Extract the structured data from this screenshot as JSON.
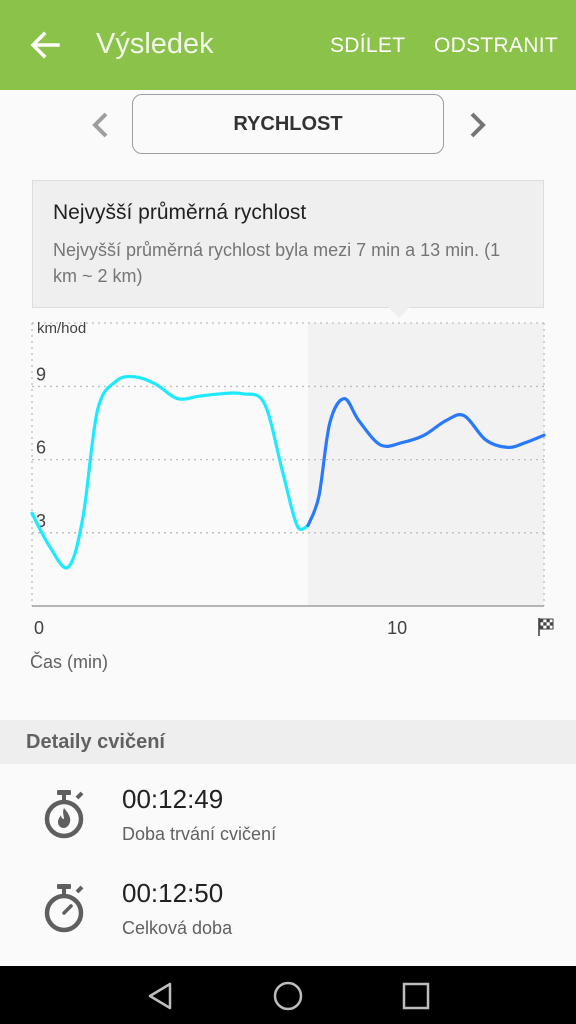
{
  "appbar": {
    "title": "Výsledek",
    "share_label": "SDÍLET",
    "delete_label": "ODSTRANIT"
  },
  "selector": {
    "current": "RYCHLOST"
  },
  "info": {
    "heading": "Nejvyšší průměrná rychlost",
    "description": "Nejvyšší průměrná rychlost byla mezi 7 min a 13 min. (1 km ~ 2 km)"
  },
  "chart_data": {
    "type": "line",
    "ylabel": "km/hod",
    "xlabel": "Čas (min)",
    "xlim": [
      0,
      14.1
    ],
    "ylim": [
      0,
      11.6
    ],
    "y_ticks": [
      "3",
      "6",
      "9"
    ],
    "x_ticks": [
      "0",
      "10"
    ],
    "end_marker": "finish-flag-icon",
    "highlight_range": [
      7.6,
      14.1
    ],
    "highlight_color": "#f2f2f2",
    "series": [
      {
        "color": "#1de9ff",
        "x": [
          0,
          0.5,
          1.0,
          1.4,
          1.8,
          2.3,
          2.8,
          3.4,
          4.0,
          4.6,
          5.2,
          5.8,
          6.4,
          6.9,
          7.3,
          7.6
        ],
        "y": [
          3.8,
          2.4,
          1.6,
          3.6,
          8.0,
          9.2,
          9.4,
          9.1,
          8.5,
          8.6,
          8.7,
          8.7,
          8.3,
          5.5,
          3.3,
          3.3
        ]
      },
      {
        "color": "#2979ff",
        "x": [
          7.6,
          7.9,
          8.2,
          8.6,
          9.0,
          9.6,
          10.2,
          10.8,
          11.4,
          11.9,
          12.5,
          13.1,
          13.6,
          14.1
        ],
        "y": [
          3.3,
          4.5,
          7.5,
          8.5,
          7.6,
          6.6,
          6.7,
          7.0,
          7.6,
          7.8,
          6.8,
          6.5,
          6.7,
          7.0
        ]
      }
    ]
  },
  "details": {
    "header": "Detaily cvičení",
    "items": [
      {
        "value": "00:12:49",
        "label": "Doba trvání cvičení",
        "icon": "stopwatch-flame-icon"
      },
      {
        "value": "00:12:50",
        "label": "Celková doba",
        "icon": "stopwatch-icon"
      }
    ]
  },
  "colors": {
    "appbar": "#8bc34a",
    "line_primary": "#1de9ff",
    "line_secondary": "#2979ff"
  }
}
